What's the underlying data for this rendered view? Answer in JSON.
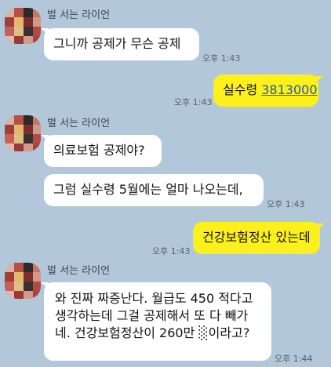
{
  "messages": [
    {
      "id": "m1",
      "sender": "벌 서는 라이언",
      "text": "그니까 공제가 무슨 공제",
      "time": "오후 1:43"
    },
    {
      "id": "m2",
      "text_prefix": "실수령 ",
      "text_link": "3813000",
      "time": "오후 1:43"
    },
    {
      "id": "m3",
      "sender": "벌 서는 라이언",
      "text": "의료보험 공제야?"
    },
    {
      "id": "m4",
      "text": "그럼 실수령 5월에는 얼마 나오는데,",
      "time": "오후 1:43"
    },
    {
      "id": "m5",
      "text": "건강보험정산 있는데",
      "time": "오후 1:43"
    },
    {
      "id": "m6",
      "sender": "벌 서는 라이언",
      "text": "와 진짜 짜증난다. 월급도 450 적다고 생각하는데 그걸 공제해서 또 다 빼가네. 건강보험정산이 260만 ░이라고?",
      "time": "오후 1:44"
    }
  ],
  "colors": {
    "background": "#b2c7d9",
    "incoming_bubble": "#ffffff",
    "outgoing_bubble": "#fef01b",
    "link": "#1d52c9"
  },
  "icons": {
    "avatar": "pixelated-profile-photo"
  }
}
